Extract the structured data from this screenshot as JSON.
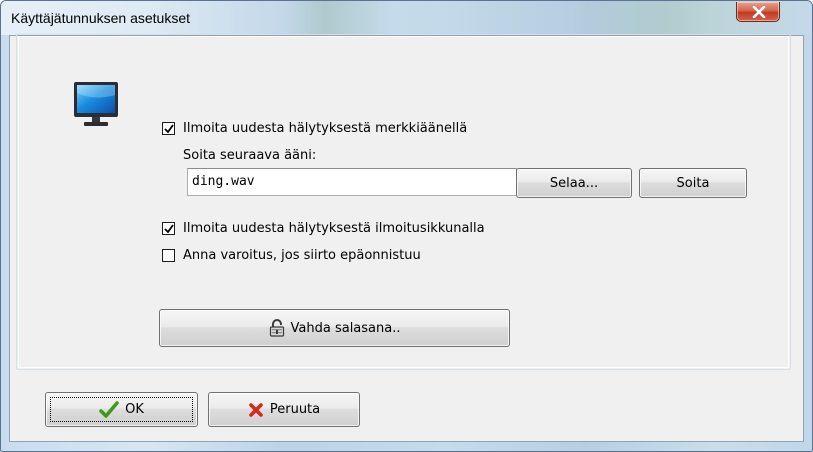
{
  "window": {
    "title": "Käyttäjätunnuksen asetukset"
  },
  "options": {
    "notify_sound_label": "Ilmoita uudesta hälytyksestä merkkiäänellä",
    "notify_sound_checked": true,
    "play_sound_label": "Soita seuraava ääni:",
    "sound_file_value": "ding.wav",
    "browse_label": "Selaa...",
    "play_label": "Soita",
    "notify_popup_label": "Ilmoita uudesta hälytyksestä ilmoitusikkunalla",
    "notify_popup_checked": true,
    "warn_transfer_label": "Anna varoitus, jos siirto epäonnistuu",
    "warn_transfer_checked": false,
    "change_password_label": "Vahda salasana.."
  },
  "footer": {
    "ok_label": "OK",
    "cancel_label": "Peruuta"
  },
  "icons": {
    "monitor": "monitor-icon",
    "padlock": "padlock-icon",
    "ok": "checkmark-icon",
    "cancel": "x-icon",
    "close": "close-icon"
  },
  "colors": {
    "ok_check": "#3f9a1a",
    "cancel_x": "#d42a16",
    "close_button": "#c94630",
    "client_background": "#f0f0f0"
  }
}
